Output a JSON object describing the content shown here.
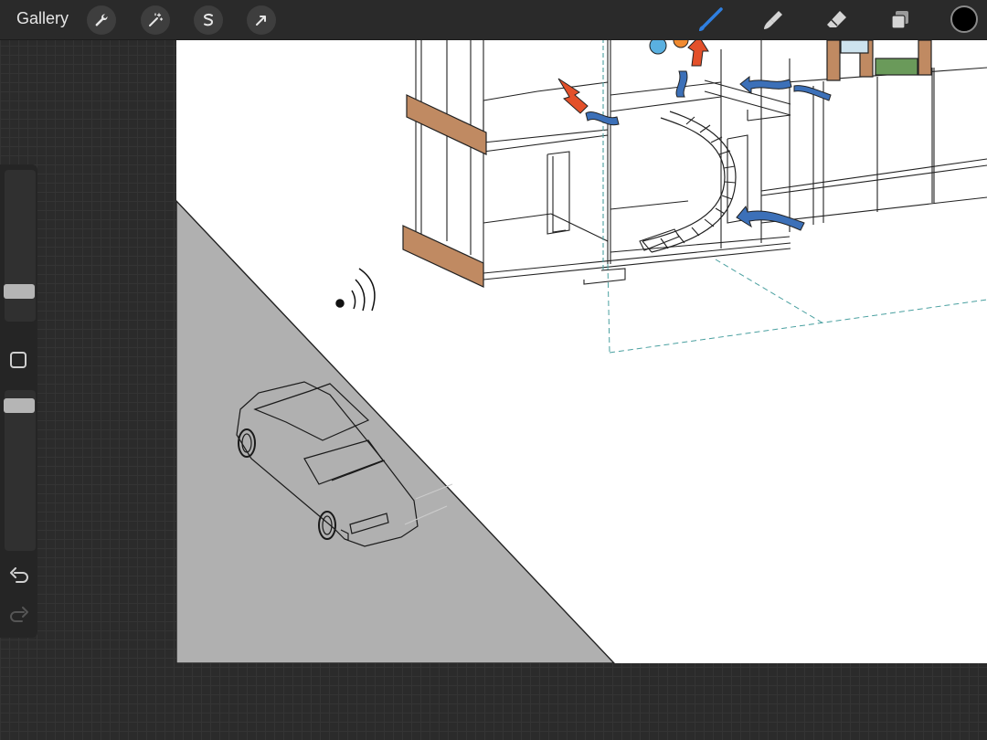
{
  "toolbar": {
    "gallery_label": "Gallery",
    "left_tools": [
      "wrench-icon",
      "magic-wand-icon",
      "selection-icon",
      "transform-arrow-icon"
    ],
    "right_tools": [
      "brush-icon",
      "smudge-icon",
      "eraser-icon",
      "layers-icon"
    ],
    "active_tool": "brush",
    "current_color": "#000000"
  },
  "sidebar": {
    "brush_size_level": 0.19,
    "opacity_level": 0.9,
    "undo_icon": "undo-icon",
    "redo_icon": "redo-icon"
  },
  "colors": {
    "canvas": "#ffffff",
    "road": "#b0b0b0",
    "timber": "#c08a62",
    "cool_air": "#3c70b8",
    "warm_air": "#e3502a",
    "guide_line": "#4aa0a0"
  }
}
